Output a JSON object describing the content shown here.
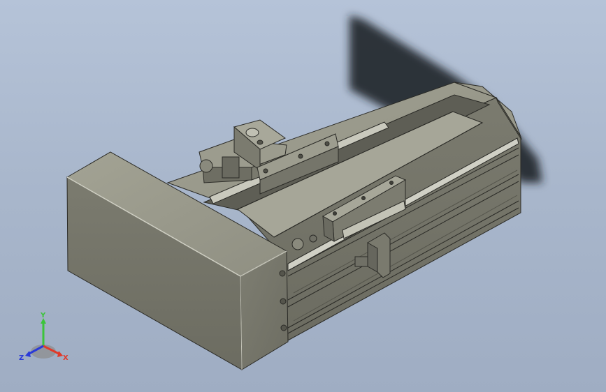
{
  "viewport": {
    "background_top": "#b5c3d8",
    "background_bottom": "#9fadc3"
  },
  "model": {
    "description_color": "#8c8c7e",
    "edge_color": "#2a2a26"
  },
  "triad": {
    "x_label": "X",
    "y_label": "Y",
    "z_label": "Z",
    "x_color": "#e03a2a",
    "y_color": "#3cc43a",
    "z_color": "#2a3ad8"
  }
}
